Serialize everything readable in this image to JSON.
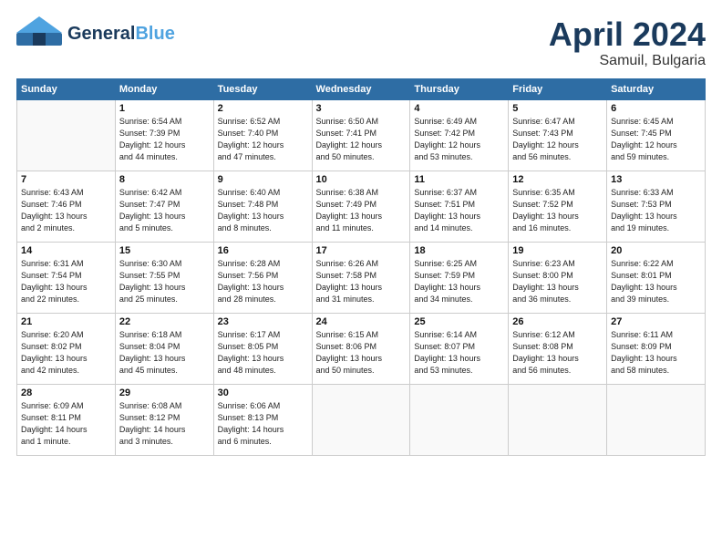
{
  "header": {
    "logo_general": "General",
    "logo_blue": "Blue",
    "month": "April 2024",
    "location": "Samuil, Bulgaria"
  },
  "weekdays": [
    "Sunday",
    "Monday",
    "Tuesday",
    "Wednesday",
    "Thursday",
    "Friday",
    "Saturday"
  ],
  "weeks": [
    [
      {
        "day": "",
        "info": ""
      },
      {
        "day": "1",
        "info": "Sunrise: 6:54 AM\nSunset: 7:39 PM\nDaylight: 12 hours\nand 44 minutes."
      },
      {
        "day": "2",
        "info": "Sunrise: 6:52 AM\nSunset: 7:40 PM\nDaylight: 12 hours\nand 47 minutes."
      },
      {
        "day": "3",
        "info": "Sunrise: 6:50 AM\nSunset: 7:41 PM\nDaylight: 12 hours\nand 50 minutes."
      },
      {
        "day": "4",
        "info": "Sunrise: 6:49 AM\nSunset: 7:42 PM\nDaylight: 12 hours\nand 53 minutes."
      },
      {
        "day": "5",
        "info": "Sunrise: 6:47 AM\nSunset: 7:43 PM\nDaylight: 12 hours\nand 56 minutes."
      },
      {
        "day": "6",
        "info": "Sunrise: 6:45 AM\nSunset: 7:45 PM\nDaylight: 12 hours\nand 59 minutes."
      }
    ],
    [
      {
        "day": "7",
        "info": "Sunrise: 6:43 AM\nSunset: 7:46 PM\nDaylight: 13 hours\nand 2 minutes."
      },
      {
        "day": "8",
        "info": "Sunrise: 6:42 AM\nSunset: 7:47 PM\nDaylight: 13 hours\nand 5 minutes."
      },
      {
        "day": "9",
        "info": "Sunrise: 6:40 AM\nSunset: 7:48 PM\nDaylight: 13 hours\nand 8 minutes."
      },
      {
        "day": "10",
        "info": "Sunrise: 6:38 AM\nSunset: 7:49 PM\nDaylight: 13 hours\nand 11 minutes."
      },
      {
        "day": "11",
        "info": "Sunrise: 6:37 AM\nSunset: 7:51 PM\nDaylight: 13 hours\nand 14 minutes."
      },
      {
        "day": "12",
        "info": "Sunrise: 6:35 AM\nSunset: 7:52 PM\nDaylight: 13 hours\nand 16 minutes."
      },
      {
        "day": "13",
        "info": "Sunrise: 6:33 AM\nSunset: 7:53 PM\nDaylight: 13 hours\nand 19 minutes."
      }
    ],
    [
      {
        "day": "14",
        "info": "Sunrise: 6:31 AM\nSunset: 7:54 PM\nDaylight: 13 hours\nand 22 minutes."
      },
      {
        "day": "15",
        "info": "Sunrise: 6:30 AM\nSunset: 7:55 PM\nDaylight: 13 hours\nand 25 minutes."
      },
      {
        "day": "16",
        "info": "Sunrise: 6:28 AM\nSunset: 7:56 PM\nDaylight: 13 hours\nand 28 minutes."
      },
      {
        "day": "17",
        "info": "Sunrise: 6:26 AM\nSunset: 7:58 PM\nDaylight: 13 hours\nand 31 minutes."
      },
      {
        "day": "18",
        "info": "Sunrise: 6:25 AM\nSunset: 7:59 PM\nDaylight: 13 hours\nand 34 minutes."
      },
      {
        "day": "19",
        "info": "Sunrise: 6:23 AM\nSunset: 8:00 PM\nDaylight: 13 hours\nand 36 minutes."
      },
      {
        "day": "20",
        "info": "Sunrise: 6:22 AM\nSunset: 8:01 PM\nDaylight: 13 hours\nand 39 minutes."
      }
    ],
    [
      {
        "day": "21",
        "info": "Sunrise: 6:20 AM\nSunset: 8:02 PM\nDaylight: 13 hours\nand 42 minutes."
      },
      {
        "day": "22",
        "info": "Sunrise: 6:18 AM\nSunset: 8:04 PM\nDaylight: 13 hours\nand 45 minutes."
      },
      {
        "day": "23",
        "info": "Sunrise: 6:17 AM\nSunset: 8:05 PM\nDaylight: 13 hours\nand 48 minutes."
      },
      {
        "day": "24",
        "info": "Sunrise: 6:15 AM\nSunset: 8:06 PM\nDaylight: 13 hours\nand 50 minutes."
      },
      {
        "day": "25",
        "info": "Sunrise: 6:14 AM\nSunset: 8:07 PM\nDaylight: 13 hours\nand 53 minutes."
      },
      {
        "day": "26",
        "info": "Sunrise: 6:12 AM\nSunset: 8:08 PM\nDaylight: 13 hours\nand 56 minutes."
      },
      {
        "day": "27",
        "info": "Sunrise: 6:11 AM\nSunset: 8:09 PM\nDaylight: 13 hours\nand 58 minutes."
      }
    ],
    [
      {
        "day": "28",
        "info": "Sunrise: 6:09 AM\nSunset: 8:11 PM\nDaylight: 14 hours\nand 1 minute."
      },
      {
        "day": "29",
        "info": "Sunrise: 6:08 AM\nSunset: 8:12 PM\nDaylight: 14 hours\nand 3 minutes."
      },
      {
        "day": "30",
        "info": "Sunrise: 6:06 AM\nSunset: 8:13 PM\nDaylight: 14 hours\nand 6 minutes."
      },
      {
        "day": "",
        "info": ""
      },
      {
        "day": "",
        "info": ""
      },
      {
        "day": "",
        "info": ""
      },
      {
        "day": "",
        "info": ""
      }
    ]
  ]
}
